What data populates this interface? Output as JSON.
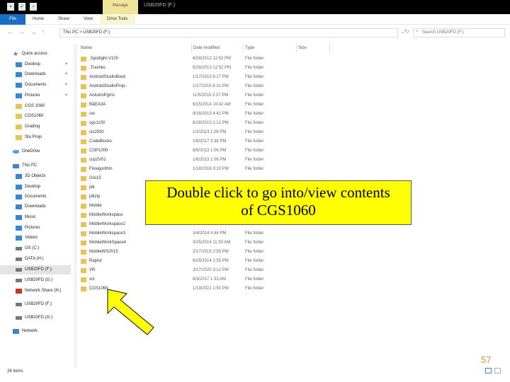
{
  "titlebar": {
    "manage_tab": "Manage",
    "title": "USB20FD (F:)"
  },
  "ribbon": {
    "tabs": [
      "File",
      "Home",
      "Share",
      "View",
      "Drive Tools"
    ]
  },
  "address": {
    "path": "This PC  >  USB20FD (F:)",
    "search_placeholder": "Search USB20FD (F:)"
  },
  "nav": {
    "items": [
      {
        "label": "Quick access",
        "icon": "star-icon",
        "pinned": false,
        "selected": false
      },
      {
        "label": "Desktop",
        "icon": "blue",
        "pinned": true,
        "selected": false
      },
      {
        "label": "Downloads",
        "icon": "blue",
        "pinned": true,
        "selected": false
      },
      {
        "label": "Documents",
        "icon": "blue",
        "pinned": true,
        "selected": false
      },
      {
        "label": "Pictures",
        "icon": "blue",
        "pinned": true,
        "selected": false
      },
      {
        "label": "CGS 1060",
        "icon": "folder",
        "pinned": false,
        "selected": false
      },
      {
        "label": "CGS1060",
        "icon": "folder",
        "pinned": false,
        "selected": false
      },
      {
        "label": "Grading",
        "icon": "folder",
        "pinned": false,
        "selected": false
      },
      {
        "label": "Stu Projs",
        "icon": "folder",
        "pinned": false,
        "selected": false
      },
      {
        "label": "OneDrive",
        "icon": "cloud",
        "pinned": false,
        "selected": false
      },
      {
        "label": "This PC",
        "icon": "pc",
        "pinned": false,
        "selected": false
      },
      {
        "label": "3D Objects",
        "icon": "blue",
        "pinned": false,
        "selected": false
      },
      {
        "label": "Desktop",
        "icon": "blue",
        "pinned": false,
        "selected": false
      },
      {
        "label": "Documents",
        "icon": "blue",
        "pinned": false,
        "selected": false
      },
      {
        "label": "Downloads",
        "icon": "blue",
        "pinned": false,
        "selected": false
      },
      {
        "label": "Music",
        "icon": "blue",
        "pinned": false,
        "selected": false
      },
      {
        "label": "Pictures",
        "icon": "blue",
        "pinned": false,
        "selected": false
      },
      {
        "label": "Videos",
        "icon": "blue",
        "pinned": false,
        "selected": false
      },
      {
        "label": "OS (C:)",
        "icon": "drive",
        "pinned": false,
        "selected": false
      },
      {
        "label": "DATA (H:)",
        "icon": "drive",
        "pinned": false,
        "selected": false
      },
      {
        "label": "USB20FD (F:)",
        "icon": "drive",
        "pinned": false,
        "selected": true
      },
      {
        "label": "USB20FD (G:)",
        "icon": "drive",
        "pinned": false,
        "selected": false
      },
      {
        "label": "Network Share (N:)",
        "icon": "red",
        "pinned": false,
        "selected": false
      },
      {
        "label": "USB20FD (F:)",
        "icon": "drive",
        "pinned": false,
        "selected": false
      },
      {
        "label": "USB20FD (G:)",
        "icon": "drive",
        "pinned": false,
        "selected": false
      },
      {
        "label": "Network",
        "icon": "blue",
        "pinned": false,
        "selected": false
      }
    ]
  },
  "columns": {
    "name": "Name",
    "date": "Date modified",
    "type": "Type",
    "size": "Size"
  },
  "files": [
    {
      "name": ".Spotlight-V100",
      "date": "6/28/2013 12:52 PM",
      "type": "File folder"
    },
    {
      "name": ".Trashes",
      "date": "6/28/2013 12:52 PM",
      "type": "File folder"
    },
    {
      "name": "AndroidStudioBook",
      "date": "1/17/2015 6:17 PM",
      "type": "File folder"
    },
    {
      "name": "AndroidStudioProjs",
      "date": "1/17/2015 6:31 PM",
      "type": "File folder"
    },
    {
      "name": "ArduinoPgms",
      "date": "11/5/2015 2:37 PM",
      "type": "File folder"
    },
    {
      "name": "B&EA3A",
      "date": "6/15/2014 10:42 AM",
      "type": "File folder"
    },
    {
      "name": "cer",
      "date": "9/16/2013 4:42 PM",
      "type": "File folder"
    },
    {
      "name": "cgs1100",
      "date": "6/28/2013 1:12 PM",
      "type": "File folder"
    },
    {
      "name": "cis2930",
      "date": "1/3/2013 1:06 PM",
      "type": "File folder"
    },
    {
      "name": "CodeBlocks",
      "date": "1/6/2017 3:38 PM",
      "type": "File folder"
    },
    {
      "name": "COP1000",
      "date": "8/6/2013 1:06 PM",
      "type": "File folder"
    },
    {
      "name": "cop2V01",
      "date": "1/6/2013 1:06 PM",
      "type": "File folder"
    },
    {
      "name": "Flowgorithm",
      "date": "1/18/2016 3:10 PM",
      "type": "File folder"
    },
    {
      "name": "Gre15",
      "date": "",
      "type": ""
    },
    {
      "name": "jdk",
      "date": "",
      "type": ""
    },
    {
      "name": "jdkzip",
      "date": "",
      "type": ""
    },
    {
      "name": "Mobile",
      "date": "",
      "type": ""
    },
    {
      "name": "MobileWorkspace",
      "date": "",
      "type": ""
    },
    {
      "name": "MobileWorkspace2",
      "date": "",
      "type": ""
    },
    {
      "name": "MobileWorkspace3",
      "date": "3/4/2014 4:44 PM",
      "type": "File folder"
    },
    {
      "name": "MobileWorkSpace4",
      "date": "3/25/2014 11:30 AM",
      "type": "File folder"
    },
    {
      "name": "MobileWS2015",
      "date": "2/17/2015 2:55 PM",
      "type": "File folder"
    },
    {
      "name": "Raptor",
      "date": "6/29/2014 2:55 PM",
      "type": "File folder"
    },
    {
      "name": "VR",
      "date": "3/17/2020 3:12 PM",
      "type": "File folder"
    },
    {
      "name": "xcl",
      "date": "6/3/2017 1:33 AM",
      "type": "File folder"
    },
    {
      "name": "CGS1060",
      "date": "1/19/2021 1:50 PM",
      "type": "File folder"
    }
  ],
  "callout": {
    "line1": "Double click to go into/view contents",
    "line2": "of CGS1060"
  },
  "status": {
    "count": "26 items"
  },
  "slide": {
    "page": "57"
  },
  "colors": {
    "callout_bg": "#ffff00",
    "arrow_fill": "#ffff00",
    "file_tab": "#1a6fc4",
    "folder": "#e9c35a"
  }
}
